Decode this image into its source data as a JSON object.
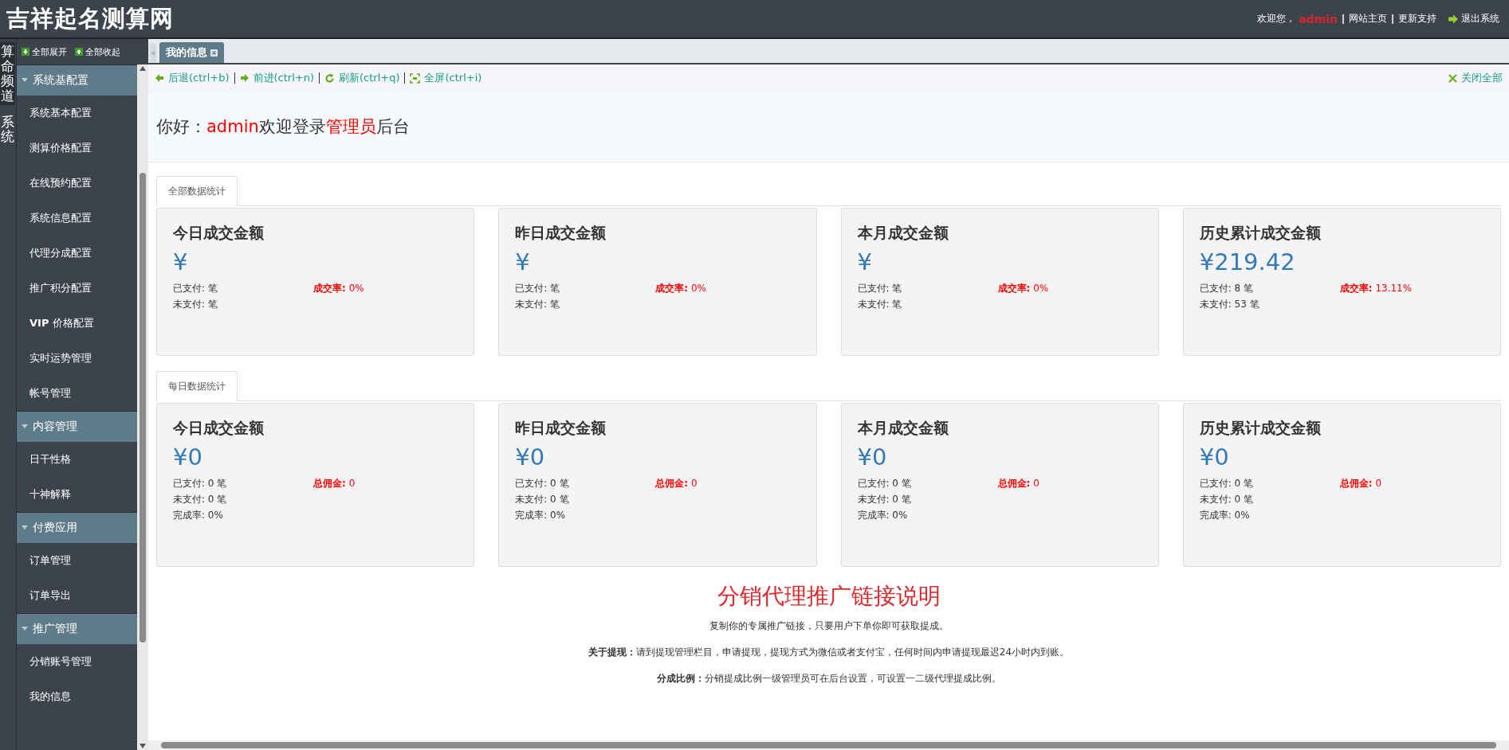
{
  "header": {
    "title": "吉祥起名测算网",
    "welcome": "欢迎您，",
    "user": "admin",
    "links": [
      "网站主页",
      "更新支持"
    ],
    "logout": "退出系统"
  },
  "side_tabs": [
    {
      "label": "算命频道",
      "selected": true
    },
    {
      "label": "系统",
      "selected": false
    }
  ],
  "sidebar": {
    "expand_all": "全部展开",
    "collapse_all": "全部收起",
    "groups": [
      {
        "title": "系统基配置",
        "expanded": true,
        "items": [
          "系统基本配置",
          "测算价格配置",
          "在线预约配置",
          "系统信息配置",
          "代理分成配置",
          "推广积分配置",
          "**VIP** 价格配置",
          "实时运势管理",
          "帐号管理"
        ]
      },
      {
        "title": "内容管理",
        "expanded": true,
        "items": [
          "日干性格",
          "十神解释"
        ]
      },
      {
        "title": "付费应用",
        "expanded": true,
        "items": [
          "订单管理",
          "订单导出"
        ]
      },
      {
        "title": "推广管理",
        "expanded": true,
        "items": [
          "分销账号管理",
          "我的信息"
        ]
      }
    ]
  },
  "tabs": [
    {
      "label": "我的信息",
      "selected": true
    }
  ],
  "toolbar": [
    {
      "kind": "back",
      "label": "后退(ctrl+b)"
    },
    {
      "kind": "forward",
      "label": "前进(ctrl+n)"
    },
    {
      "kind": "refresh",
      "label": "刷新(ctrl+q)"
    },
    {
      "kind": "fullscreen",
      "label": "全屏(ctrl+i)"
    }
  ],
  "close_all": "关闭全部",
  "greeting": [
    {
      "text": "你好：",
      "highlight": false
    },
    {
      "text": "admin",
      "highlight": true
    },
    {
      "text": "欢迎登录",
      "highlight": false
    },
    {
      "text": "管理员",
      "highlight": true
    },
    {
      "text": "后台",
      "highlight": false
    }
  ],
  "sections": [
    {
      "tab": "全部数据统计",
      "cards": [
        {
          "title": "今日成交金额",
          "amount": "¥",
          "lines": [
            "已支付: 笔",
            "未支付: 笔"
          ],
          "rate_label": "成交率:",
          "rate_value": "0%"
        },
        {
          "title": "昨日成交金额",
          "amount": "¥",
          "lines": [
            "已支付: 笔",
            "未支付: 笔"
          ],
          "rate_label": "成交率:",
          "rate_value": "0%"
        },
        {
          "title": "本月成交金额",
          "amount": "¥",
          "lines": [
            "已支付: 笔",
            "未支付: 笔"
          ],
          "rate_label": "成交率:",
          "rate_value": "0%"
        },
        {
          "title": "历史累计成交金额",
          "amount": "¥219.42",
          "lines": [
            "已支付: 8 笔",
            "未支付: 53 笔"
          ],
          "rate_label": "成交率:",
          "rate_value": "13.11%"
        }
      ]
    },
    {
      "tab": "每日数据统计",
      "cards": [
        {
          "title": "今日成交金额",
          "amount": "¥0",
          "lines": [
            "已支付: 0 笔",
            "未支付: 0 笔",
            "完成率: 0%"
          ],
          "rate_label": "总佣金:",
          "rate_value": "0"
        },
        {
          "title": "昨日成交金额",
          "amount": "¥0",
          "lines": [
            "已支付: 0 笔",
            "未支付: 0 笔",
            "完成率: 0%"
          ],
          "rate_label": "总佣金:",
          "rate_value": "0"
        },
        {
          "title": "本月成交金额",
          "amount": "¥0",
          "lines": [
            "已支付: 0 笔",
            "未支付: 0 笔",
            "完成率: 0%"
          ],
          "rate_label": "总佣金:",
          "rate_value": "0"
        },
        {
          "title": "历史累计成交金额",
          "amount": "¥0",
          "lines": [
            "已支付: 0 笔",
            "未支付: 0 笔",
            "完成率: 0%"
          ],
          "rate_label": "总佣金:",
          "rate_value": "0"
        }
      ]
    }
  ],
  "explanation": {
    "title": "分销代理推广链接说明",
    "paragraphs": [
      "复制你的专属推广链接，只要用户下单你即可获取提成。",
      "**关于提现：**请到提现管理栏目，申请提现，提现方式为微信或者支付宝，任何时间内申请提现最迟24小时内到账。",
      "**分成比例：**分销提成比例一级管理员可在后台设置，可设置一二级代理提成比例。"
    ]
  }
}
